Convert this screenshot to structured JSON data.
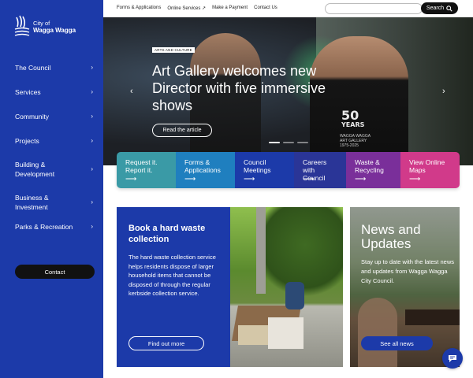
{
  "logo": {
    "line1": "City of",
    "line2": "Wagga Wagga"
  },
  "nav": [
    {
      "label": "The Council",
      "chevron": "›"
    },
    {
      "label": "Services",
      "chevron": "›"
    },
    {
      "label": "Community",
      "chevron": "›"
    },
    {
      "label": "Projects",
      "chevron": "›"
    },
    {
      "label": "Building & Development",
      "chevron": "›"
    },
    {
      "label": "Business & Investment",
      "chevron": "›"
    },
    {
      "label": "Parks & Recreation",
      "chevron": "›"
    }
  ],
  "contact_label": "Contact",
  "toplinks": [
    "Forms & Applications",
    "Online Services ↗",
    "Make a Payment",
    "Contact Us"
  ],
  "search": {
    "placeholder": "",
    "button_label": "Search"
  },
  "hero": {
    "tag": "ARTS AND CULTURE",
    "title": "Art Gallery welcomes new Director with five immersive shows",
    "button": "Read the article",
    "shirt_number": "50",
    "shirt_word": "YEARS",
    "shirt_sub": "WAGGA WAGGA ART GALLERY 1975-2025",
    "slides": 3,
    "active_slide": 1
  },
  "tiles": [
    {
      "label": "Request it. Report it.",
      "color": "#3a9aa6"
    },
    {
      "label": "Forms & Applications",
      "color": "#1f7fbf"
    },
    {
      "label": "Council Meetings",
      "color": "#1c3aa9"
    },
    {
      "label": "Careers with Council",
      "color": "#2a3597"
    },
    {
      "label": "Waste & Recycling",
      "color": "#7a2f9a"
    },
    {
      "label": "View Online Maps",
      "color": "#d13a8a"
    }
  ],
  "waste": {
    "title": "Book a hard waste collection",
    "body": "The hard waste collection service helps residents dispose of larger household items that cannot be disposed of through the regular kerbside collection service.",
    "button": "Find out more"
  },
  "news": {
    "title": "News and Updates",
    "body": "Stay up to date with the latest news and updates from Wagga Wagga City Council.",
    "button": "See all news"
  },
  "colors": {
    "brand": "#1c3aa9",
    "dark": "#111111"
  },
  "icons": [
    "wagga-logo-icon",
    "chevron-right-icon",
    "search-icon",
    "arrow-right-icon",
    "chat-icon",
    "external-link-icon"
  ]
}
